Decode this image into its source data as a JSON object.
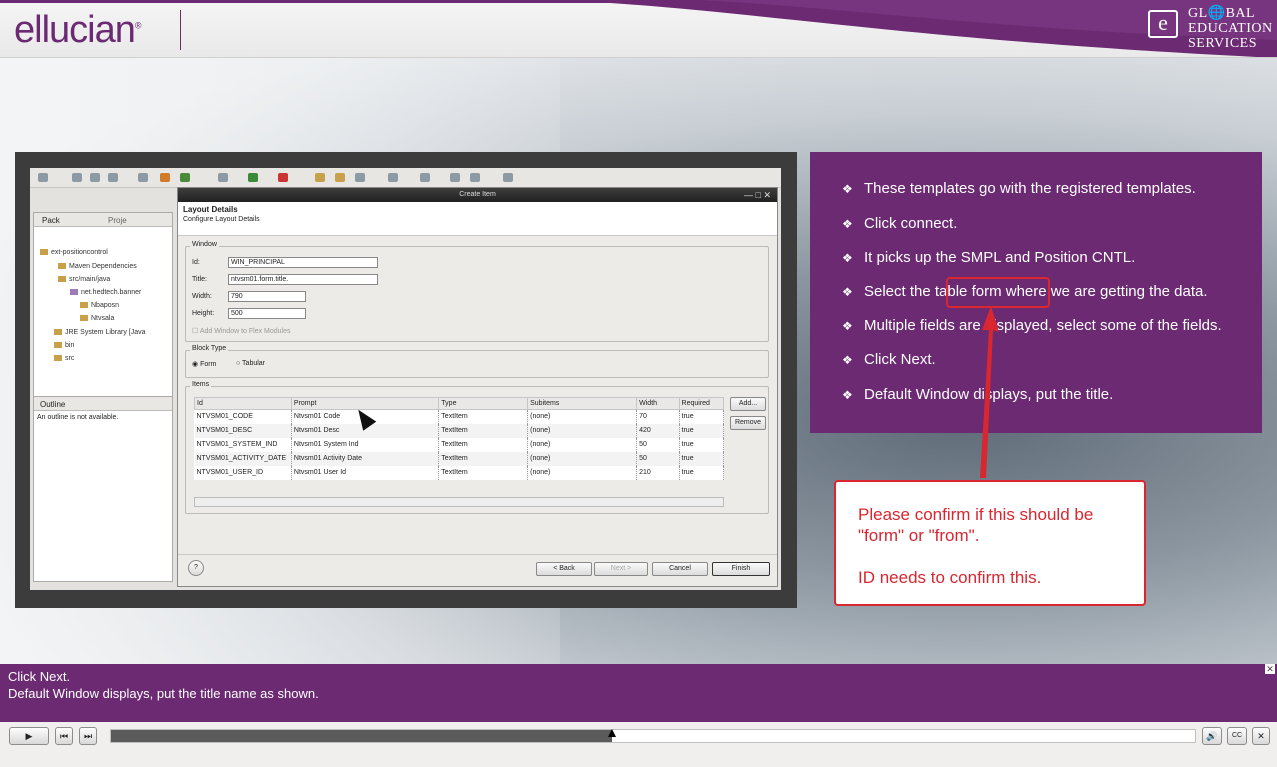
{
  "header": {
    "brand": "ellucian",
    "brand_reg": "®",
    "ges_e": "e",
    "ges_line1": "GL🌐BAL",
    "ges_line2": "EDUCATION",
    "ges_line3": "SERVICES",
    "accent_color": "#6b2a72"
  },
  "screenshot": {
    "left_tabs": [
      "Pack",
      "Proje"
    ],
    "tree": [
      "ext-positioncontrol",
      "Maven Dependencies",
      "src/main/java",
      "net.hedtech.banner",
      "Nbaposn",
      "Ntvsala",
      "JRE System Library [Java",
      "bin",
      "src"
    ],
    "outline_tab": "Outline",
    "outline_text": "An outline is not available.",
    "dialog_title": "Create Item",
    "dialog_heading": "Layout Details",
    "dialog_sub": "Configure Layout Details",
    "window_group": "Window",
    "fields": [
      {
        "label": "Id:",
        "value": "WIN_PRINCIPAL"
      },
      {
        "label": "Title:",
        "value": "ntvsm01.form.title."
      },
      {
        "label": "Width:",
        "value": "790"
      },
      {
        "label": "Height:",
        "value": "500"
      }
    ],
    "add_window_label": "Add Window to Flex Modules",
    "block_type_group": "Block Type",
    "radio_form": "Form",
    "radio_tabular": "Tabular",
    "items_group": "Items",
    "columns": [
      "Id",
      "Prompt",
      "Type",
      "Subitems",
      "Width",
      "Required"
    ],
    "rows": [
      [
        "NTVSM01_CODE",
        "Ntvsm01 Code",
        "TextItem",
        "(none)",
        "70",
        "true"
      ],
      [
        "NTVSM01_DESC",
        "Ntvsm01 Desc",
        "TextItem",
        "(none)",
        "420",
        "true"
      ],
      [
        "NTVSM01_SYSTEM_IND",
        "Ntvsm01 System Ind",
        "TextItem",
        "(none)",
        "50",
        "true"
      ],
      [
        "NTVSM01_ACTIVITY_DATE",
        "Ntvsm01 Activity Date",
        "TextItem",
        "(none)",
        "50",
        "true"
      ],
      [
        "NTVSM01_USER_ID",
        "Ntvsm01 User Id",
        "TextItem",
        "(none)",
        "210",
        "true"
      ]
    ],
    "add_btn": "Add...",
    "remove_btn": "Remove",
    "back_btn": "< Back",
    "next_btn": "Next >",
    "cancel_btn": "Cancel",
    "finish_btn": "Finish",
    "help": "?"
  },
  "notes": {
    "items": [
      "These templates go with the registered templates.",
      "Click connect.",
      "It picks up the SMPL and Position CNTL.",
      "Select the table form where we are getting the data.",
      "Multiple fields are displayed, select some of the fields.",
      "Click Next.",
      "Default Window displays, put the title."
    ],
    "bullet_glyph": "❖"
  },
  "callout": {
    "line1": "Please confirm if this should be",
    "line2": "\"form\" or \"from\".",
    "line3": "ID needs to confirm this."
  },
  "caption": {
    "line1": "Click Next.",
    "line2": "Default Window displays, put the title name as shown."
  },
  "player": {
    "progress": 0.462,
    "play": "▶",
    "prev": "⏮",
    "next": "⏭",
    "volume": "🔊",
    "cc": "CC",
    "close": "✕"
  }
}
